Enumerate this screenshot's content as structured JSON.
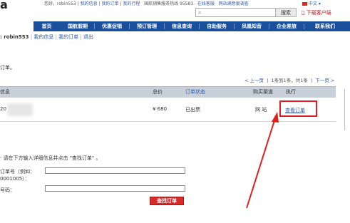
{
  "header": {
    "logo_fragment": "a",
    "top_links": {
      "greeting": "您好，robin553",
      "my_info": "我的信息",
      "my_orders": "我的订单",
      "my_itinerary": "我的行程",
      "hotline": "国航销售服务热线 95583",
      "online_service": "在线客服",
      "online_survey": "网站满意度调查"
    },
    "language": "中文",
    "search": {
      "placeholder": "",
      "button": "搜索"
    },
    "download_link": "下载客户端"
  },
  "nav": {
    "items": [
      {
        "label": "首页",
        "active": true
      },
      {
        "label": "国航假期",
        "active": false
      },
      {
        "label": "优惠促销",
        "active": false
      },
      {
        "label": "预订管理",
        "active": false
      },
      {
        "label": "信息查询",
        "active": false
      },
      {
        "label": "自助服务",
        "active": false
      },
      {
        "label": "凤凰知音",
        "active": false
      },
      {
        "label": "企业差旅",
        "active": false
      },
      {
        "label": "联系我们",
        "active": false
      }
    ]
  },
  "user_bar": {
    "username": ": robin553",
    "links": [
      "我的信息",
      "我的订单",
      "退出"
    ]
  },
  "orders": {
    "heading": "订单。",
    "pager": {
      "prev": "< 上一页",
      "info": "1条到1条，共1条",
      "next": "下一页 >"
    },
    "columns": [
      {
        "label": "信息",
        "blue": false
      },
      {
        "label": "总价",
        "blue": false
      },
      {
        "label": "订单状态",
        "blue": true
      },
      {
        "label": "购买渠道",
        "blue": false
      },
      {
        "label": "执行",
        "blue": false
      }
    ],
    "rows": [
      {
        "info": "20",
        "total": "¥ 680",
        "status": "已出票",
        "channel": "网 站",
        "action": "查看订单"
      }
    ]
  },
  "search_form": {
    "instruction": "请在下方输入详细信息并点击 \"查找订单\" 。",
    "order_label_line1": "订单号（例如：",
    "order_label_line2": "0001005）：",
    "id_label": "号码：",
    "order_value": "",
    "id_value": "",
    "submit": "查找订单"
  },
  "colors": {
    "nav_bg": "#1a4f9c",
    "link": "#2f5aa8",
    "highlight": "#e02020",
    "button_red": "#d92a2a"
  }
}
